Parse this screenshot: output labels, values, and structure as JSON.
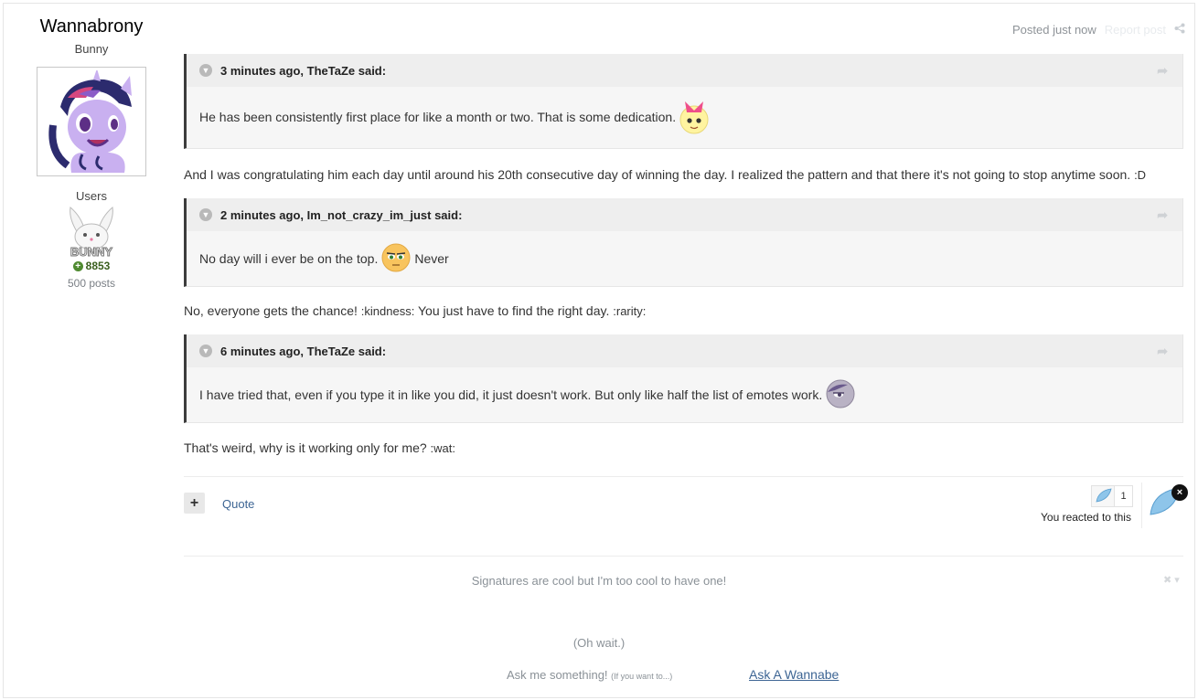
{
  "author": {
    "name": "Wannabrony",
    "title": "Bunny",
    "group": "Users",
    "rank_icon": "bunny-badge-icon",
    "rank_text": "BUNNY",
    "reputation": "8853",
    "posts": "500 posts"
  },
  "meta": {
    "posted": "Posted just now",
    "report": "Report post",
    "share_icon": "share-icon"
  },
  "quotes": [
    {
      "header": "3 minutes ago, TheTaZe said:",
      "body": "He has been consistently first place for like a month or two. That is some dedication.",
      "emote": "applebloom-emote"
    },
    {
      "header": "2 minutes ago, Im_not_crazy_im_just said:",
      "body": "No day will i ever be on the top.",
      "body_after": "Never",
      "emote": "applejack-emote"
    },
    {
      "header": "6 minutes ago, TheTaZe said:",
      "body": "I have tried that, even if you type it in like you did, it just doesn't work. But only like half the list of emotes work.",
      "emote": "maud-emote"
    }
  ],
  "paragraphs": {
    "p1": "And I was congratulating him each day until around his 20th consecutive day of winning the day. I realized the pattern and that there it's not going to stop anytime soon.",
    "p1_code": ":D",
    "p2_a": "No, everyone gets the chance!",
    "p2_code1": ":kindness:",
    "p2_b": "You just have to find the right day.",
    "p2_code2": ":rarity:",
    "p3": "That's weird, why is it working only for me?",
    "p3_code": ":wat:"
  },
  "controls": {
    "plus": "+",
    "quote": "Quote",
    "reaction_count": "1",
    "reacted": "You reacted to this",
    "close": "×"
  },
  "signature": {
    "line1": "Signatures are cool but I'm too cool to have one!",
    "line2": "(Oh wait.)",
    "ask": "Ask me something!",
    "ask_small": "(If you want to...)",
    "ask_link": "Ask A Wannabe",
    "ctrl": "✖ ▾"
  },
  "colors": {
    "link": "#3d6594",
    "quote_border": "#3c3c3c",
    "reputation": "#4f8a30",
    "reaction": "#8ec5ea"
  }
}
